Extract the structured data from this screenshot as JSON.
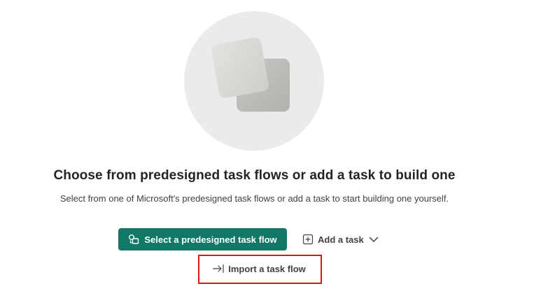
{
  "empty_state": {
    "illustration": "overlapping-squares-illustration",
    "headline": "Choose from predesigned task flows or add a task to build one",
    "description": "Select from one of Microsoft's predesigned task flows or add a task to start building one yourself."
  },
  "actions": {
    "select_predesigned": {
      "label": "Select a predesigned task flow",
      "icon": "task-flow-icon",
      "color": "#117865"
    },
    "add_task": {
      "label": "Add a task",
      "icon": "add-square-icon",
      "dropdown_icon": "chevron-down-icon"
    },
    "import_task_flow": {
      "label": "Import a task flow",
      "icon": "arrow-import-icon"
    }
  },
  "highlight": {
    "color": "#d21a1a",
    "target": "import_task_flow"
  }
}
